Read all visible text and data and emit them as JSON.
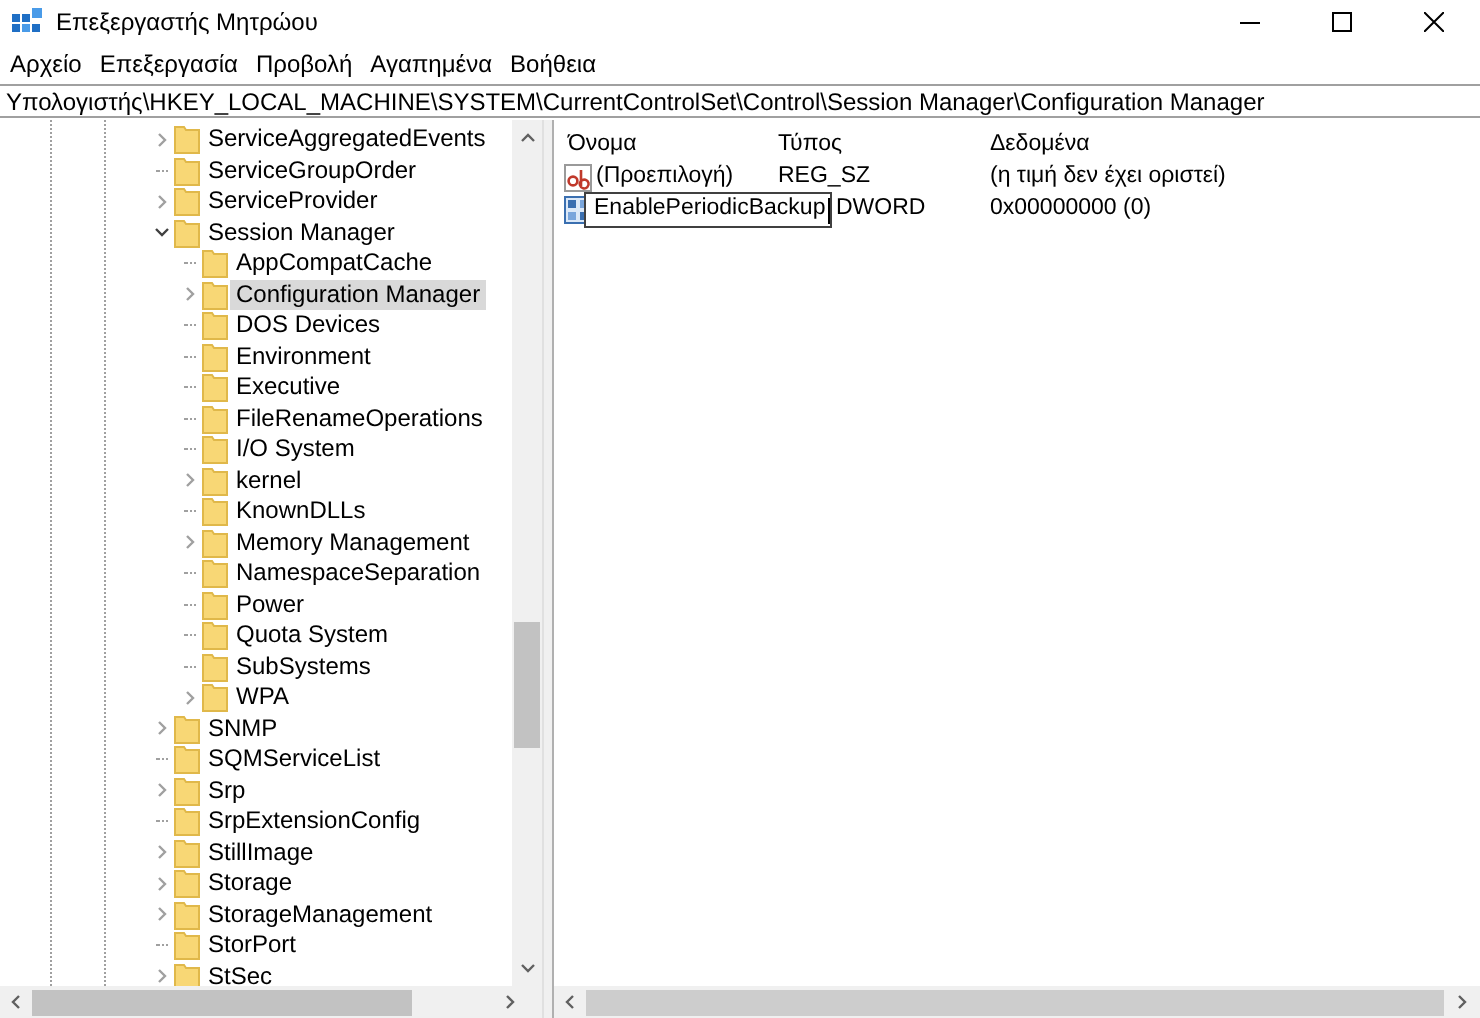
{
  "window": {
    "title": "Επεξεργαστής Μητρώου"
  },
  "menu": [
    "Αρχείο",
    "Επεξεργασία",
    "Προβολή",
    "Αγαπημένα",
    "Βοήθεια"
  ],
  "address": "Υπολογιστής\\HKEY_LOCAL_MACHINE\\SYSTEM\\CurrentControlSet\\Control\\Session Manager\\Configuration Manager",
  "tree": [
    {
      "label": "ServiceAggregatedEvents",
      "expandable": true,
      "expanded": false,
      "selected": false
    },
    {
      "label": "ServiceGroupOrder",
      "expandable": false,
      "expanded": false,
      "selected": false
    },
    {
      "label": "ServiceProvider",
      "expandable": true,
      "expanded": false,
      "selected": false
    },
    {
      "label": "Session Manager",
      "expandable": true,
      "expanded": true,
      "selected": false,
      "children": [
        {
          "label": "AppCompatCache",
          "expandable": false,
          "expanded": false,
          "selected": false
        },
        {
          "label": "Configuration Manager",
          "expandable": true,
          "expanded": false,
          "selected": true
        },
        {
          "label": "DOS Devices",
          "expandable": false,
          "expanded": false,
          "selected": false
        },
        {
          "label": "Environment",
          "expandable": false,
          "expanded": false,
          "selected": false
        },
        {
          "label": "Executive",
          "expandable": false,
          "expanded": false,
          "selected": false
        },
        {
          "label": "FileRenameOperations",
          "expandable": false,
          "expanded": false,
          "selected": false
        },
        {
          "label": "I/O System",
          "expandable": false,
          "expanded": false,
          "selected": false
        },
        {
          "label": "kernel",
          "expandable": true,
          "expanded": false,
          "selected": false
        },
        {
          "label": "KnownDLLs",
          "expandable": false,
          "expanded": false,
          "selected": false
        },
        {
          "label": "Memory Management",
          "expandable": true,
          "expanded": false,
          "selected": false
        },
        {
          "label": "NamespaceSeparation",
          "expandable": false,
          "expanded": false,
          "selected": false
        },
        {
          "label": "Power",
          "expandable": false,
          "expanded": false,
          "selected": false
        },
        {
          "label": "Quota System",
          "expandable": false,
          "expanded": false,
          "selected": false
        },
        {
          "label": "SubSystems",
          "expandable": false,
          "expanded": false,
          "selected": false
        },
        {
          "label": "WPA",
          "expandable": true,
          "expanded": false,
          "selected": false
        }
      ]
    },
    {
      "label": "SNMP",
      "expandable": true,
      "expanded": false,
      "selected": false
    },
    {
      "label": "SQMServiceList",
      "expandable": false,
      "expanded": false,
      "selected": false
    },
    {
      "label": "Srp",
      "expandable": true,
      "expanded": false,
      "selected": false
    },
    {
      "label": "SrpExtensionConfig",
      "expandable": false,
      "expanded": false,
      "selected": false
    },
    {
      "label": "StillImage",
      "expandable": true,
      "expanded": false,
      "selected": false
    },
    {
      "label": "Storage",
      "expandable": true,
      "expanded": false,
      "selected": false
    },
    {
      "label": "StorageManagement",
      "expandable": true,
      "expanded": false,
      "selected": false
    },
    {
      "label": "StorPort",
      "expandable": false,
      "expanded": false,
      "selected": false
    },
    {
      "label": "StSec",
      "expandable": true,
      "expanded": false,
      "selected": false
    }
  ],
  "values": {
    "columns": [
      "Όνομα",
      "Τύπος",
      "Δεδομένα"
    ],
    "rows": [
      {
        "kind": "string",
        "name": "(Προεπιλογή)",
        "type": "REG_SZ",
        "data": "(η τιμή δεν έχει οριστεί)",
        "editing": false
      },
      {
        "kind": "dword",
        "name": "EnablePeriodicBackup",
        "type": "DWORD",
        "data": "0x00000000 (0)",
        "editing": true
      }
    ]
  }
}
